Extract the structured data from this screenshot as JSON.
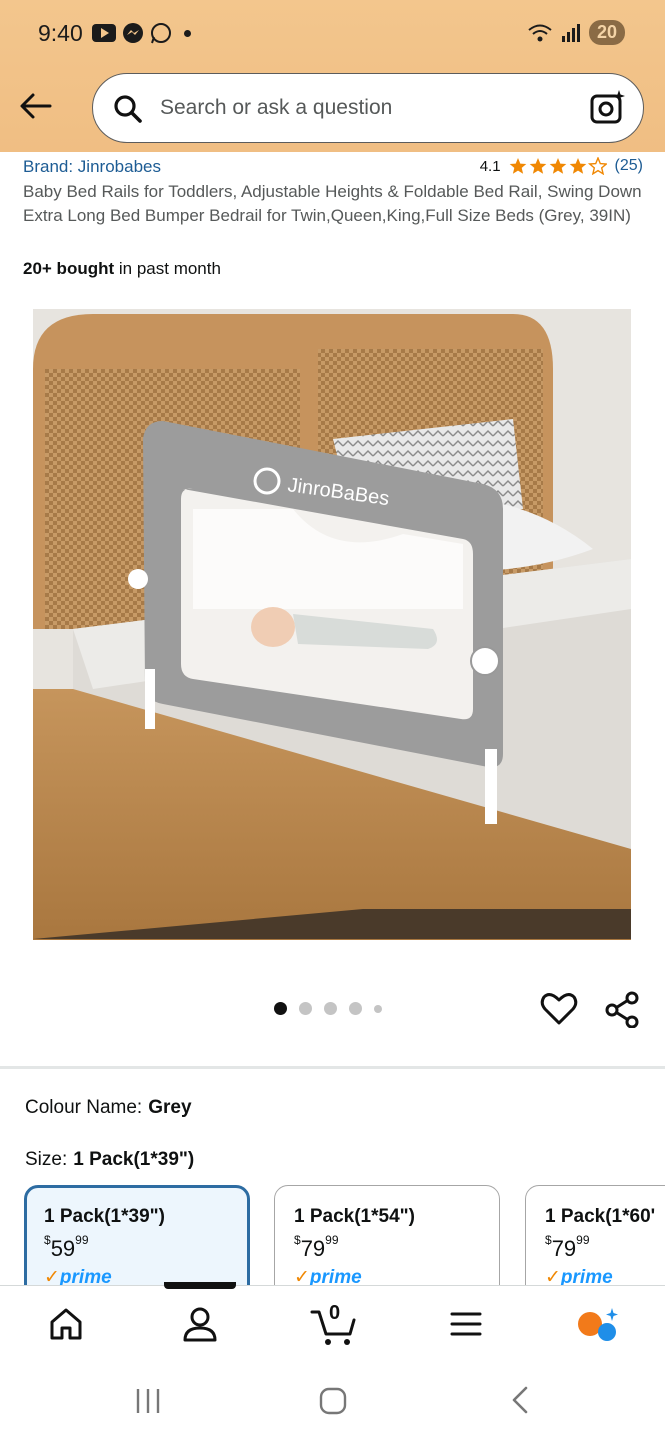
{
  "status": {
    "time": "9:40",
    "battery": "20"
  },
  "search": {
    "placeholder": "Search or ask a question"
  },
  "product": {
    "brand": "Brand: Jinrobabes",
    "rating": "4.1",
    "stars": 4.1,
    "review_count": "(25)",
    "title": "Baby Bed Rails for Toddlers, Adjustable Heights & Foldable Bed Rail, Swing Down Extra Long Bed Bumper Bedrail for Twin,Queen,King,Full Size Beds (Grey, 39IN)",
    "bought_bold": "20+ bought",
    "bought_rest": " in past month",
    "image_logo_text": "JinroBaBes"
  },
  "variations": {
    "colour_label": "Colour Name:",
    "colour_value": "Grey",
    "size_label": "Size:",
    "size_value": "1 Pack(1*39\")",
    "options": [
      {
        "label": "1 Pack(1*39\")",
        "price_dollars": "59",
        "price_cents": "99",
        "prime": "prime",
        "selected": true
      },
      {
        "label": "1 Pack(1*54\")",
        "price_dollars": "79",
        "price_cents": "99",
        "prime": "prime",
        "selected": false
      },
      {
        "label": "1 Pack(1*60'",
        "price_dollars": "79",
        "price_cents": "99",
        "prime": "prime",
        "selected": false
      }
    ]
  },
  "cart_count": "0",
  "colors": {
    "header": "#f3c68d",
    "link": "#1d5c94",
    "star": "#f08804",
    "prime": "#1a98ff",
    "selected_border": "#2d6ca2"
  }
}
